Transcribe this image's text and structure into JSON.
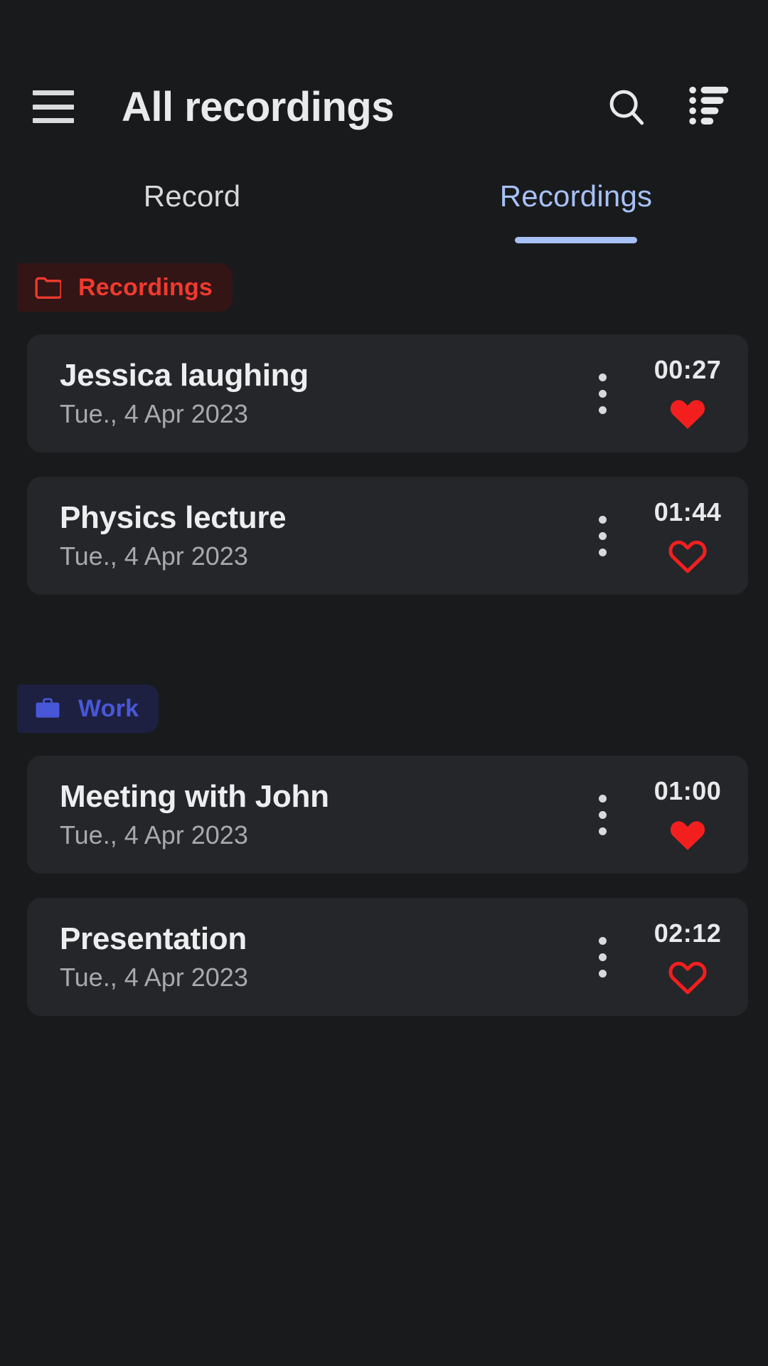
{
  "appbar": {
    "menu_icon": "hamburger-menu-icon",
    "title": "All recordings",
    "search_icon": "search-icon",
    "sort_icon": "sort-icon"
  },
  "tabs": [
    {
      "label": "Record",
      "active": false
    },
    {
      "label": "Recordings",
      "active": true
    }
  ],
  "colors": {
    "background": "#191a1c",
    "card": "#242629",
    "accent_tab": "#a7c1f5",
    "chip_recordings_text": "#f03a2e",
    "chip_recordings_bg": "#331516",
    "chip_work_text": "#4857d8",
    "chip_work_bg": "#1d2040",
    "heart": "#f31f1f"
  },
  "groups": [
    {
      "chip": {
        "label": "Recordings",
        "icon": "folder-icon"
      },
      "items": [
        {
          "title": "Jessica laughing",
          "date": "Tue., 4 Apr 2023",
          "duration": "00:27",
          "favorite": true,
          "menu_icon": "more-vertical-icon",
          "heart_icon": "heart-filled-icon"
        },
        {
          "title": "Physics lecture",
          "date": "Tue., 4 Apr 2023",
          "duration": "01:44",
          "favorite": false,
          "menu_icon": "more-vertical-icon",
          "heart_icon": "heart-outline-icon"
        }
      ]
    },
    {
      "chip": {
        "label": "Work",
        "icon": "briefcase-icon"
      },
      "items": [
        {
          "title": "Meeting with John",
          "date": "Tue., 4 Apr 2023",
          "duration": "01:00",
          "favorite": true,
          "menu_icon": "more-vertical-icon",
          "heart_icon": "heart-filled-icon"
        },
        {
          "title": "Presentation",
          "date": "Tue., 4 Apr 2023",
          "duration": "02:12",
          "favorite": false,
          "menu_icon": "more-vertical-icon",
          "heart_icon": "heart-outline-icon"
        }
      ]
    }
  ]
}
